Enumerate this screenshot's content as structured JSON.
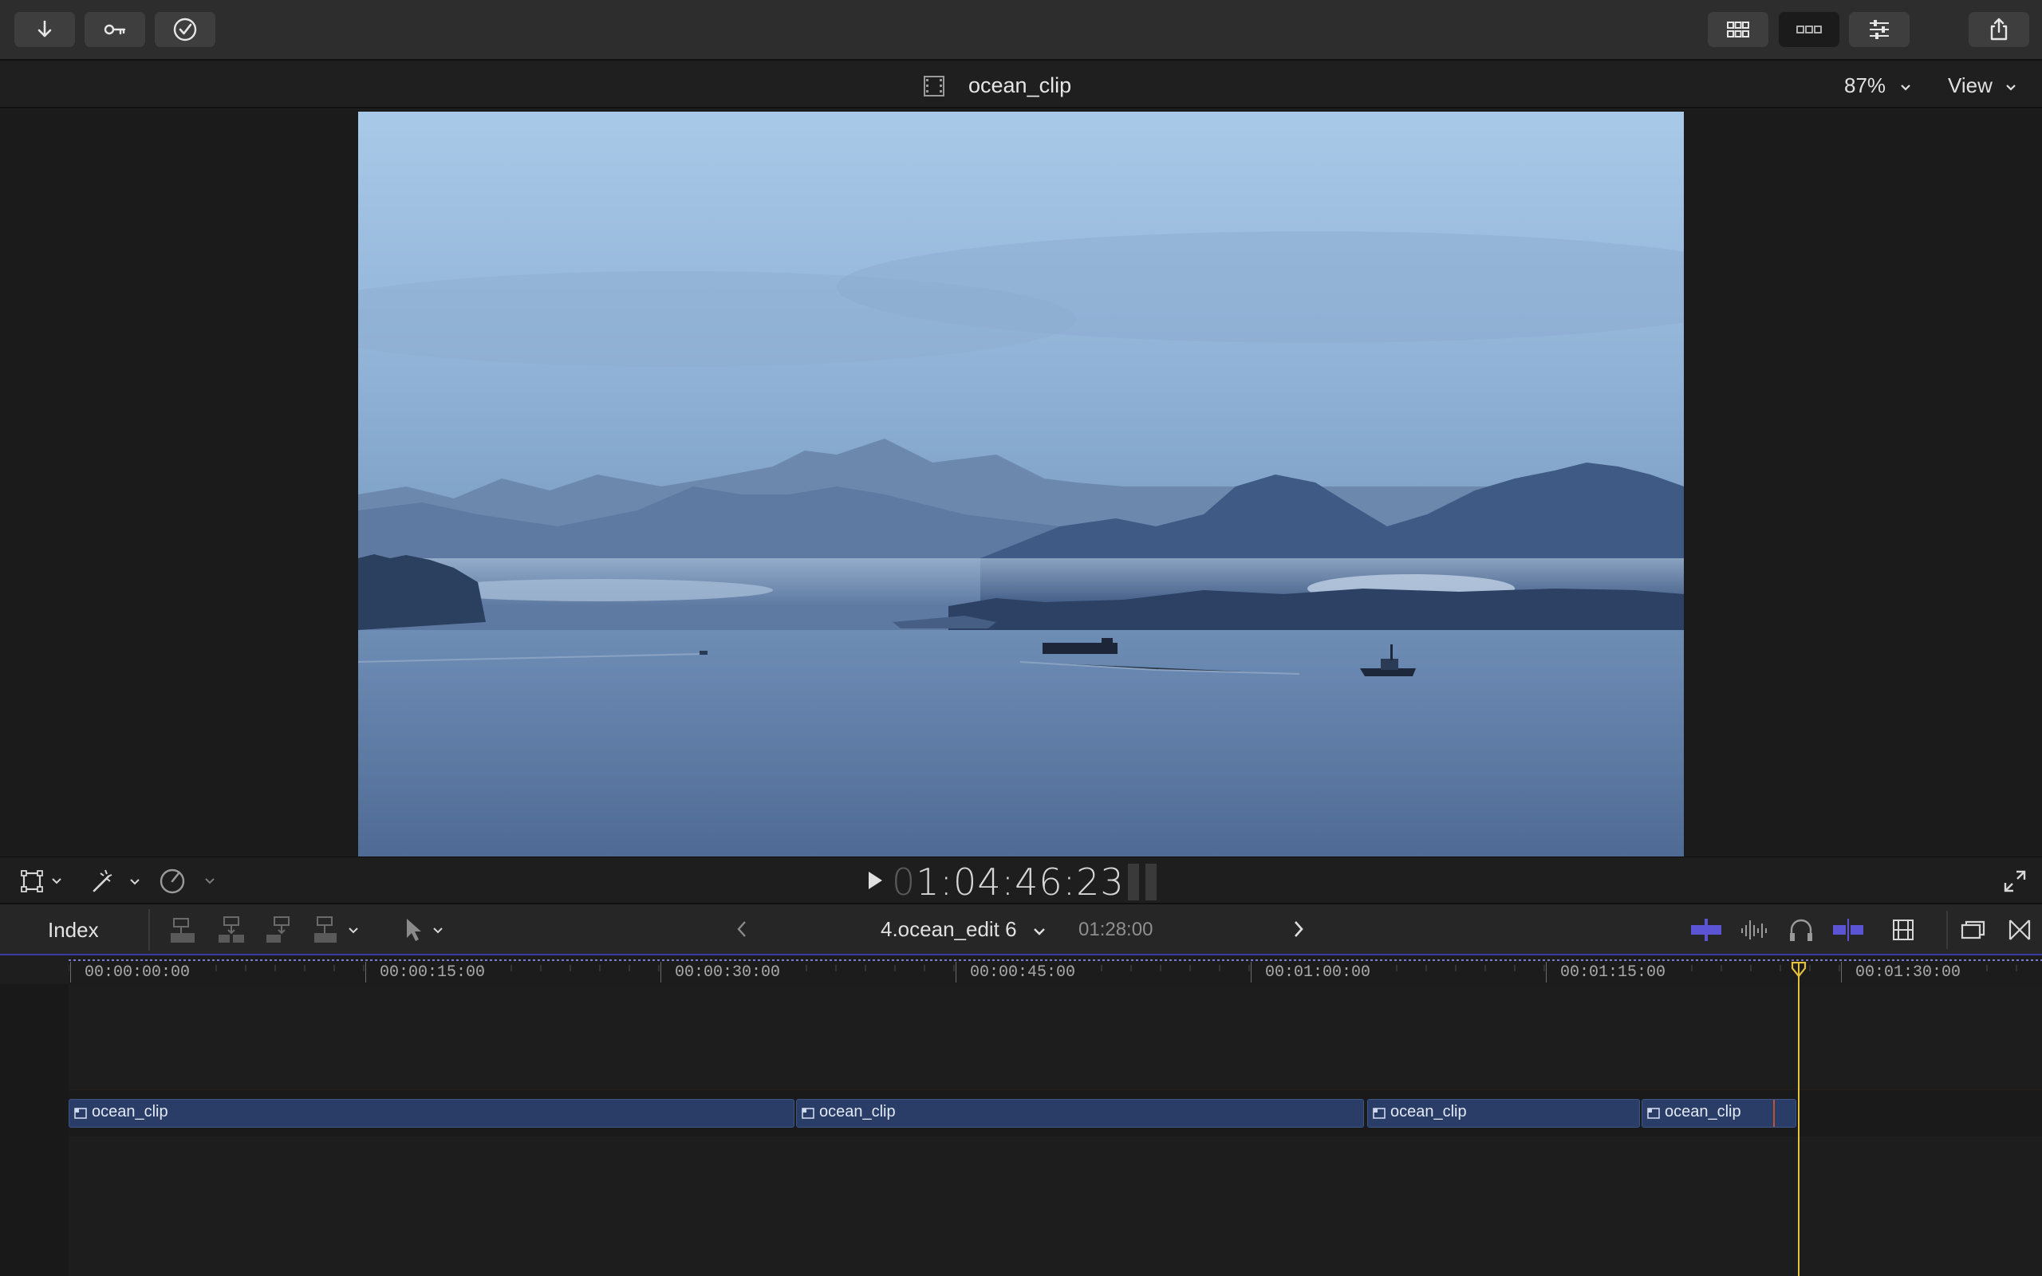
{
  "toolbar": {
    "left_buttons": [
      "import-icon",
      "keyword-icon",
      "checkmark-icon"
    ],
    "right_buttons": [
      "browser-grid-icon",
      "timeline-toggle-icon",
      "inspector-icon"
    ],
    "share_icon": "share-icon"
  },
  "viewer": {
    "clip_title": "ocean_clip",
    "zoom": "87%",
    "view_menu": "View"
  },
  "transport": {
    "timecode_dim": "0",
    "timecode": "1:04:46:23"
  },
  "timeline_header": {
    "index_label": "Index",
    "project_name": "4.ocean_edit 6",
    "project_duration": "01:28:00"
  },
  "ruler": {
    "ticks": [
      "00:00:00:00",
      "00:00:15:00",
      "00:00:30:00",
      "00:00:45:00",
      "00:01:00:00",
      "00:01:15:00",
      "00:01:30:00"
    ]
  },
  "clips": [
    {
      "label": "ocean_clip"
    },
    {
      "label": "ocean_clip"
    },
    {
      "label": "ocean_clip"
    },
    {
      "label": "ocean_clip"
    }
  ],
  "colors": {
    "clip_fill": "#2a3d66",
    "playhead": "#e3c13a",
    "accent": "#5b55d6"
  }
}
